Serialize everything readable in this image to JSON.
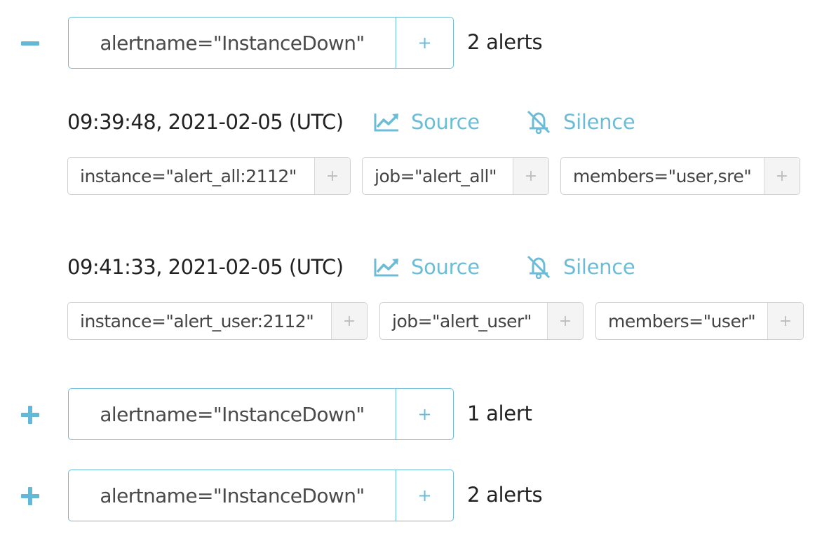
{
  "colors": {
    "accent": "#63b8d6",
    "border": "#6cbcd8",
    "chip_border": "#cfcfcf",
    "text": "#222222"
  },
  "groups": [
    {
      "expanded": true,
      "toggle_icon": "minus-icon",
      "label": "alertname=\"InstanceDown\"",
      "plus": "+",
      "count": "2 alerts",
      "alerts": [
        {
          "timestamp": "09:39:48, 2021-02-05 (UTC)",
          "source": "Source",
          "silence": "Silence",
          "labels": [
            {
              "text": "instance=\"alert_all:2112\"",
              "plus": "+"
            },
            {
              "text": "job=\"alert_all\"",
              "plus": "+"
            },
            {
              "text": "members=\"user,sre\"",
              "plus": "+"
            }
          ]
        },
        {
          "timestamp": "09:41:33, 2021-02-05 (UTC)",
          "source": "Source",
          "silence": "Silence",
          "labels": [
            {
              "text": "instance=\"alert_user:2112\"",
              "plus": "+"
            },
            {
              "text": "job=\"alert_user\"",
              "plus": "+"
            },
            {
              "text": "members=\"user\"",
              "plus": "+"
            }
          ]
        }
      ]
    },
    {
      "expanded": false,
      "toggle_icon": "plus-icon",
      "label": "alertname=\"InstanceDown\"",
      "plus": "+",
      "count": "1 alert"
    },
    {
      "expanded": false,
      "toggle_icon": "plus-icon",
      "label": "alertname=\"InstanceDown\"",
      "plus": "+",
      "count": "2 alerts"
    }
  ]
}
